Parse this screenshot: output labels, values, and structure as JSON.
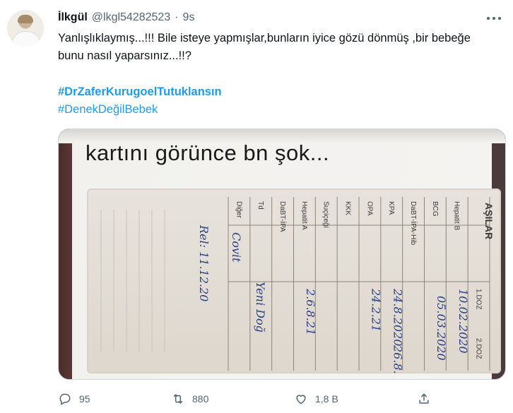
{
  "tweet": {
    "author_name": "İlkgül",
    "author_handle": "@lkgl54282523",
    "separator": "·",
    "time": "9s",
    "text": "Yanlışlıklaymış...!!! Bile isteye yapmışlar,bunların iyice gözü dönmüş ,bir bebeğe bunu nasıl yaparsınız...!!?",
    "hashtags": [
      "#DrZaferKurugoelTutuklansın",
      "#DenekDeğilBebek"
    ],
    "media": {
      "caption": "kartını görünce bn şok...",
      "card_title": "AŞILAR",
      "columns": [
        "1.DOZ",
        "2.DOZ"
      ],
      "rows": [
        "Hepatit B",
        "BCG",
        "DaBT-İPA-Hib",
        "KPA",
        "OPA",
        "KKK",
        "Suçiçeği",
        "Hepatit A",
        "DaBT-İPA",
        "Td",
        "Diğer"
      ],
      "handwritten": [
        "10.02.2020",
        "05.03.2020",
        "24.8.2020",
        "24.2.21",
        "26.8.21",
        "2.6.8.21",
        "Covit",
        "Yeni Doğ",
        "Rel: 11.12.20"
      ]
    },
    "actions": {
      "replies": "95",
      "retweets": "880",
      "likes": "1,8 B",
      "share": ""
    }
  }
}
